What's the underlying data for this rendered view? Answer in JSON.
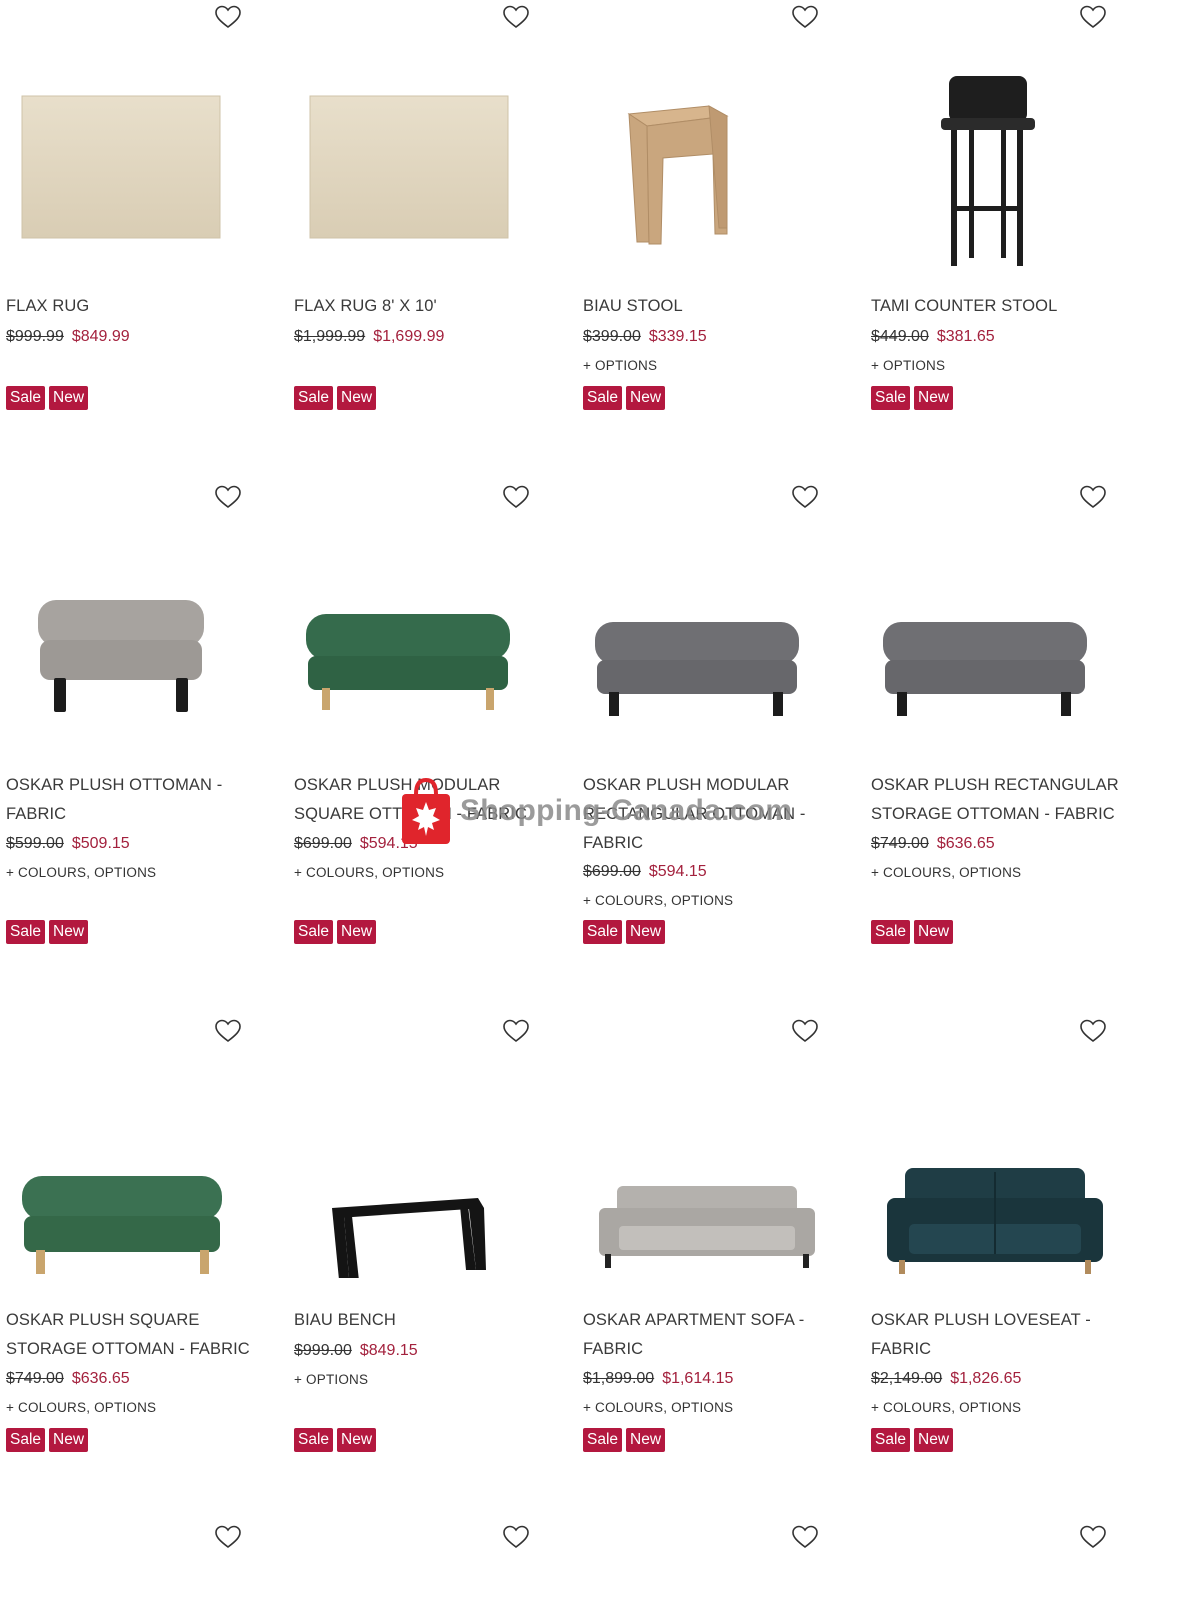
{
  "watermark": {
    "text": "Shopping-Canada.com"
  },
  "labels": {
    "sale": "Sale",
    "new": "New"
  },
  "products": [
    {
      "name": "FLAX RUG",
      "old_price": "$999.99",
      "price": "$849.99",
      "options": "",
      "image": "flax-rug"
    },
    {
      "name": "FLAX RUG 8' X 10'",
      "old_price": "$1,999.99",
      "price": "$1,699.99",
      "options": "",
      "image": "flax-rug"
    },
    {
      "name": "BIAU STOOL",
      "old_price": "$399.00",
      "price": "$339.15",
      "options": "+ OPTIONS",
      "image": "biau-stool"
    },
    {
      "name": "TAMI COUNTER STOOL",
      "old_price": "$449.00",
      "price": "$381.65",
      "options": "+ OPTIONS",
      "image": "tami-stool"
    },
    {
      "name": "OSKAR PLUSH OTTOMAN - FABRIC",
      "old_price": "$599.00",
      "price": "$509.15",
      "options": "+ COLOURS, OPTIONS",
      "image": "ottoman-grey-light"
    },
    {
      "name": "OSKAR PLUSH MODULAR SQUARE OTTOMAN - FABRIC",
      "old_price": "$699.00",
      "price": "$594.15",
      "options": "+ COLOURS, OPTIONS",
      "image": "ottoman-green"
    },
    {
      "name": "OSKAR PLUSH MODULAR RECTANGULAR OTTOMAN - FABRIC",
      "old_price": "$699.00",
      "price": "$594.15",
      "options": "+ COLOURS, OPTIONS",
      "image": "ottoman-grey-dark"
    },
    {
      "name": "OSKAR PLUSH RECTANGULAR STORAGE OTTOMAN - FABRIC",
      "old_price": "$749.00",
      "price": "$636.65",
      "options": "+ COLOURS, OPTIONS",
      "image": "ottoman-grey-dark"
    },
    {
      "name": "OSKAR PLUSH SQUARE STORAGE OTTOMAN - FABRIC",
      "old_price": "$749.00",
      "price": "$636.65",
      "options": "+ COLOURS, OPTIONS",
      "image": "ottoman-green-wide"
    },
    {
      "name": "BIAU BENCH",
      "old_price": "$999.00",
      "price": "$849.15",
      "options": "+ OPTIONS",
      "image": "biau-bench"
    },
    {
      "name": "OSKAR APARTMENT SOFA - FABRIC",
      "old_price": "$1,899.00",
      "price": "$1,614.15",
      "options": "+ COLOURS, OPTIONS",
      "image": "sofa-grey"
    },
    {
      "name": "OSKAR PLUSH LOVESEAT - FABRIC",
      "old_price": "$2,149.00",
      "price": "$1,826.65",
      "options": "+ COLOURS, OPTIONS",
      "image": "loveseat-teal"
    }
  ]
}
